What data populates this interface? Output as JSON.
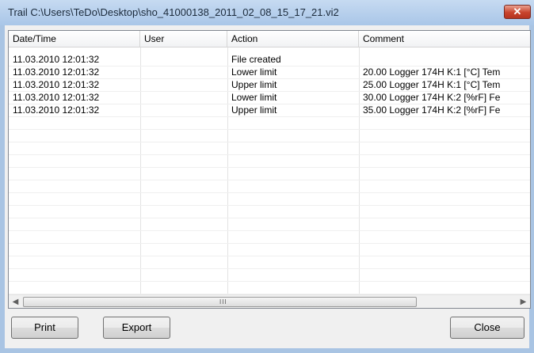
{
  "window": {
    "title": "Trail C:\\Users\\TeDo\\Desktop\\sho_41000138_2011_02_08_15_17_21.vi2",
    "close_glyph": "✕"
  },
  "table": {
    "columns": [
      "Date/Time",
      "User",
      "Action",
      "Comment"
    ],
    "rows": [
      {
        "datetime": "11.03.2010 12:01:32",
        "user": "",
        "action": "File created",
        "comment": ""
      },
      {
        "datetime": "11.03.2010 12:01:32",
        "user": "",
        "action": "Lower limit",
        "comment": "20.00 Logger 174H  K:1 [°C] Tem"
      },
      {
        "datetime": "11.03.2010 12:01:32",
        "user": "",
        "action": "Upper limit",
        "comment": "25.00 Logger 174H  K:1 [°C] Tem"
      },
      {
        "datetime": "11.03.2010 12:01:32",
        "user": "",
        "action": "Lower limit",
        "comment": "30.00 Logger 174H  K:2 [%rF] Fe"
      },
      {
        "datetime": "11.03.2010 12:01:32",
        "user": "",
        "action": "Upper limit",
        "comment": "35.00 Logger 174H  K:2 [%rF] Fe"
      }
    ]
  },
  "scrollbar": {
    "left_arrow": "◀",
    "right_arrow": "▶",
    "grip": "III"
  },
  "buttons": {
    "print": "Print",
    "export": "Export",
    "close": "Close"
  }
}
